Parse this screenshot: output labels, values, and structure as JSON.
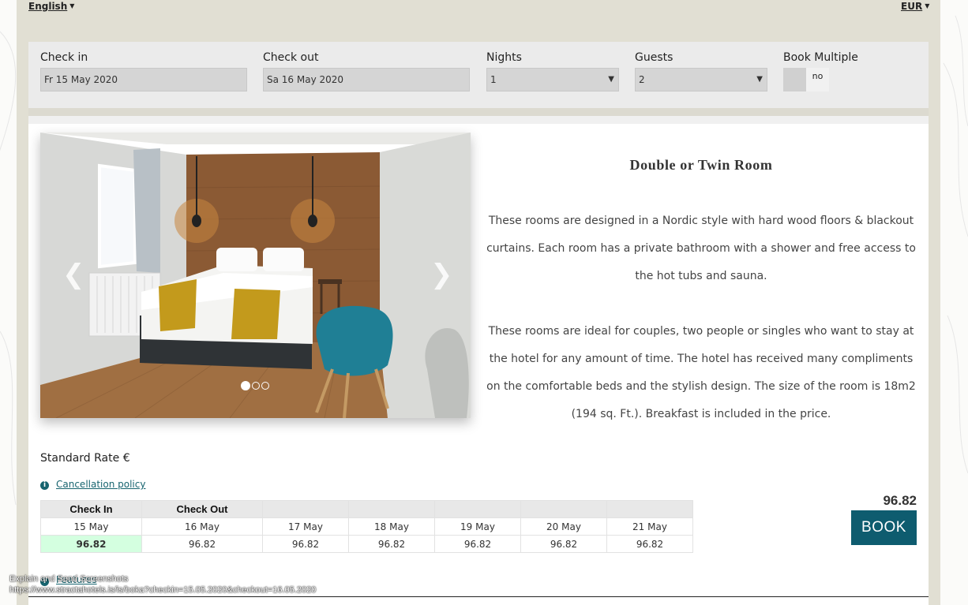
{
  "header": {
    "language": "English",
    "currency": "EUR"
  },
  "search": {
    "checkin_label": "Check in",
    "checkin_value": "Fr 15 May 2020",
    "checkout_label": "Check out",
    "checkout_value": "Sa 16 May 2020",
    "nights_label": "Nights",
    "nights_value": "1",
    "guests_label": "Guests",
    "guests_value": "2",
    "multi_label": "Book Multiple",
    "multi_value": "no"
  },
  "room": {
    "title": "Double or Twin Room",
    "description_1": "These rooms are designed in a Nordic style with hard wood floors & blackout curtains. Each room has a private bathroom with a shower and free access to the hot tubs and sauna.",
    "description_2": "These rooms are ideal for couples, two people or singles who want to stay at the hotel for any amount of time. The hotel has received many compliments on the comfortable beds and the stylish design. The size of the room is 18m2 (194 sq. Ft.). Breakfast is included in the price.",
    "carousel_slides": 3,
    "carousel_active": 1
  },
  "rate": {
    "label": "Standard Rate €",
    "cancellation_link": "Cancellation policy",
    "table_headers": [
      "Check In",
      "Check Out",
      "",
      "",
      "",
      "",
      ""
    ],
    "dates": [
      "15 May",
      "16 May",
      "17 May",
      "18 May",
      "19 May",
      "20 May",
      "21 May"
    ],
    "prices": [
      "96.82",
      "96.82",
      "96.82",
      "96.82",
      "96.82",
      "96.82",
      "96.82"
    ],
    "total": "96.82",
    "book_label": "BOOK",
    "features_link": "Features"
  },
  "overlay": {
    "line1": "Explain and Send Screenshots",
    "line2": "https://www.stracta­hotels.is/is/boka?checkin=15.05.2020&checkout=16.05.2020"
  },
  "colors": {
    "accent": "#0e5c6f",
    "link": "#17646f",
    "selected_cell": "#d4ffe0",
    "frame": "#e1dfd3"
  }
}
